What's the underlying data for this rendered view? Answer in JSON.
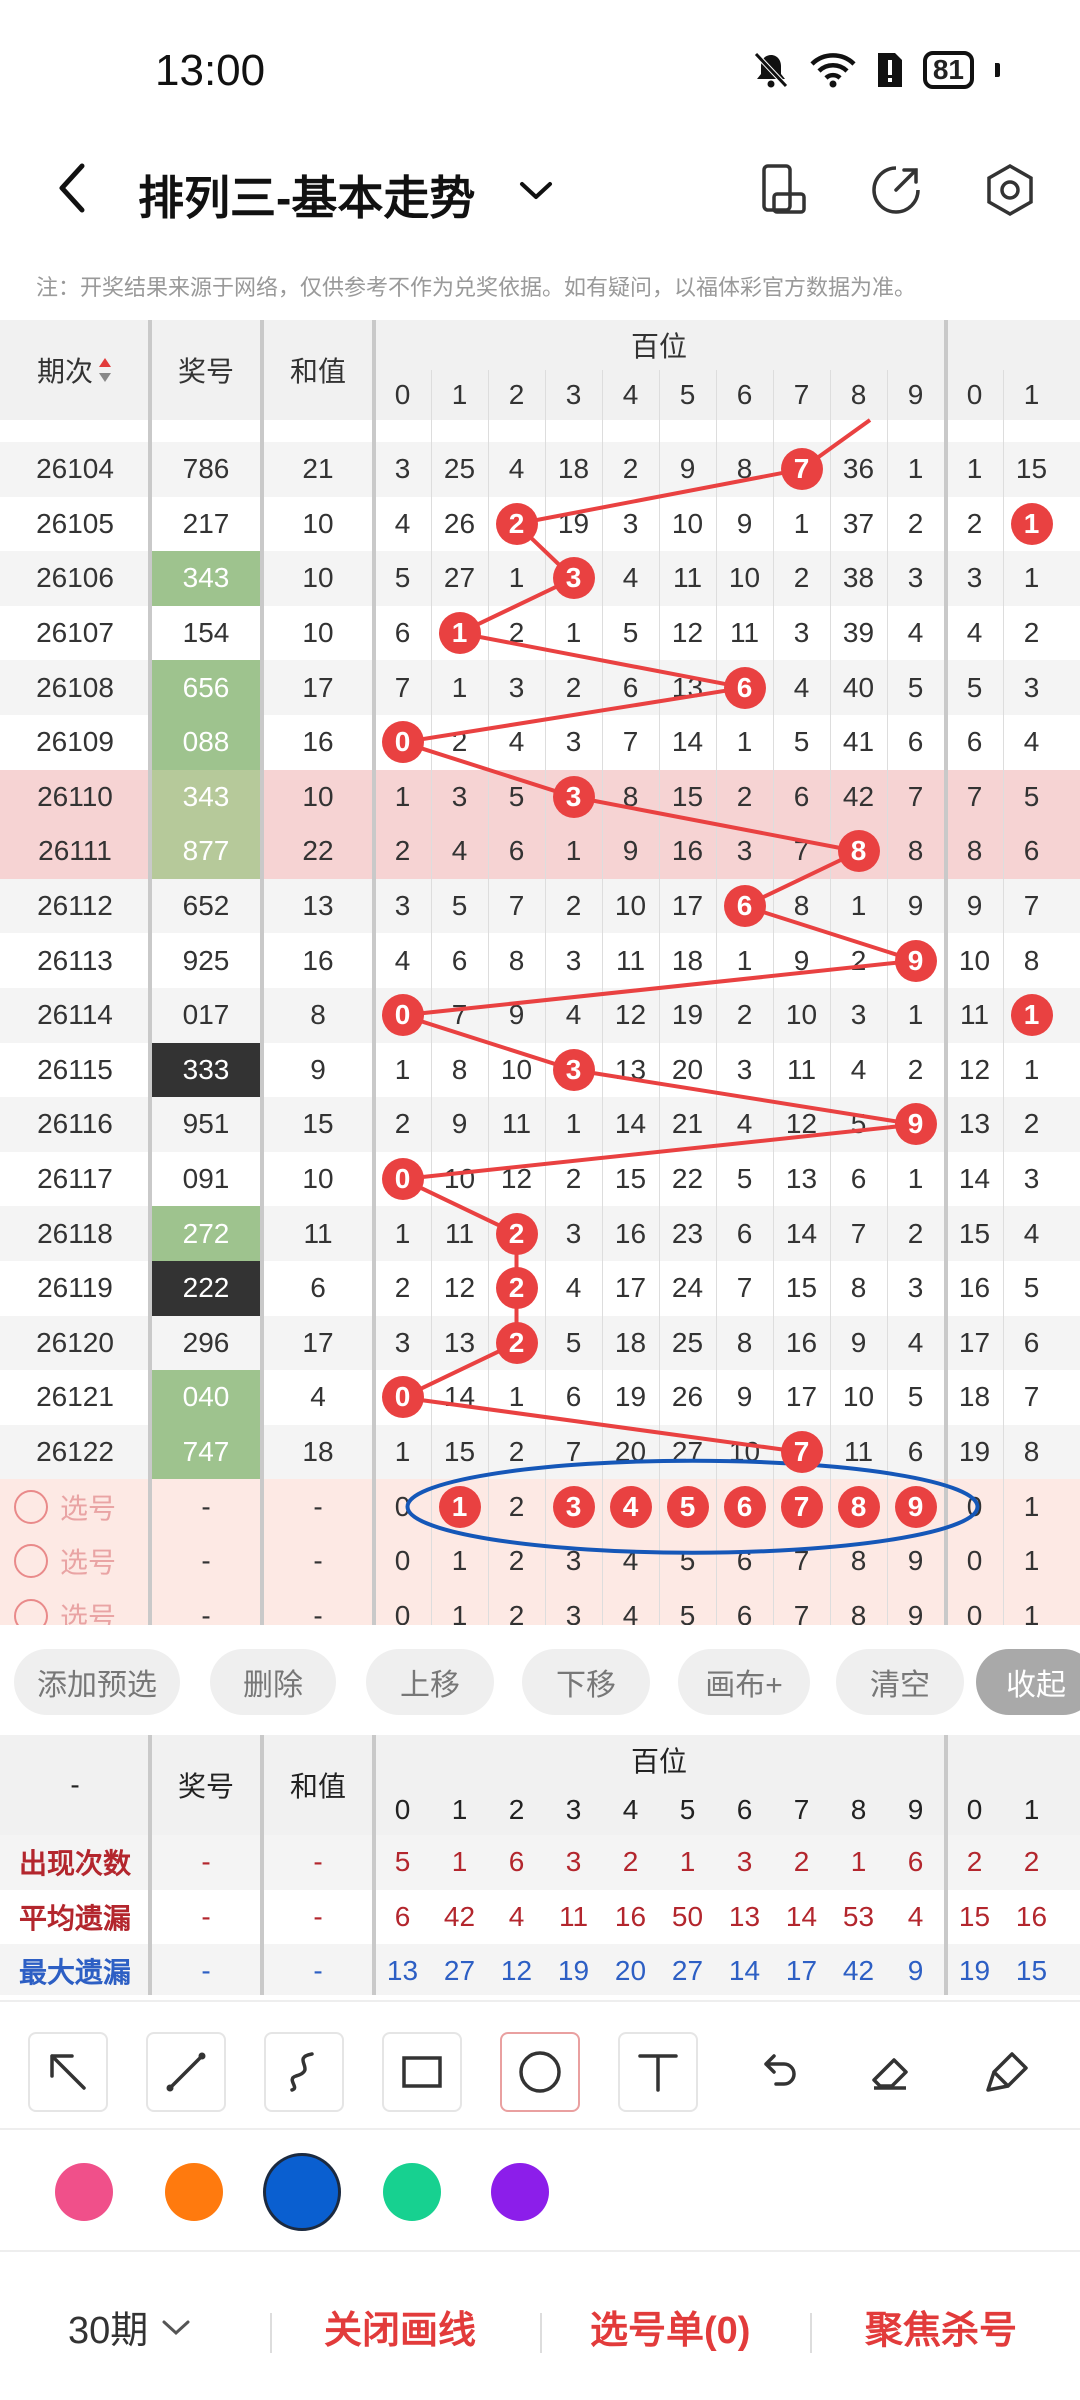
{
  "status_bar": {
    "time": "13:00",
    "battery": "81"
  },
  "header": {
    "title": "排列三-基本走势"
  },
  "notice": "注：开奖结果来源于网络，仅供参考不作为兑奖依据。如有疑问，以福体彩官方数据为准。",
  "table": {
    "col_period": "期次",
    "col_number": "奖号",
    "col_sum": "和值",
    "group_label": "百位",
    "digits": [
      "0",
      "1",
      "2",
      "3",
      "4",
      "5",
      "6",
      "7",
      "8",
      "9"
    ],
    "right_digits": [
      "0",
      "1"
    ],
    "rows": [
      {
        "period": "26104",
        "number": "786",
        "sum": "21",
        "hundreds": 7,
        "cells": [
          "3",
          "25",
          "4",
          "18",
          "2",
          "9",
          "8",
          "",
          "36",
          "1"
        ],
        "right": [
          "1",
          "15"
        ],
        "num_bg": "none"
      },
      {
        "period": "26105",
        "number": "217",
        "sum": "10",
        "hundreds": 2,
        "cells": [
          "4",
          "26",
          "",
          "19",
          "3",
          "10",
          "9",
          "1",
          "37",
          "2"
        ],
        "right": [
          "2",
          ""
        ],
        "num_bg": "none"
      },
      {
        "period": "26106",
        "number": "343",
        "sum": "10",
        "hundreds": 3,
        "cells": [
          "5",
          "27",
          "1",
          "",
          "4",
          "11",
          "10",
          "2",
          "38",
          "3"
        ],
        "right": [
          "3",
          "1"
        ],
        "num_bg": "green"
      },
      {
        "period": "26107",
        "number": "154",
        "sum": "10",
        "hundreds": 1,
        "cells": [
          "6",
          "",
          "2",
          "1",
          "5",
          "12",
          "11",
          "3",
          "39",
          "4"
        ],
        "right": [
          "4",
          "2"
        ],
        "num_bg": "none"
      },
      {
        "period": "26108",
        "number": "656",
        "sum": "17",
        "hundreds": 6,
        "cells": [
          "7",
          "1",
          "3",
          "2",
          "6",
          "13",
          "",
          "4",
          "40",
          "5"
        ],
        "right": [
          "5",
          "3"
        ],
        "num_bg": "green"
      },
      {
        "period": "26109",
        "number": "088",
        "sum": "16",
        "hundreds": 0,
        "cells": [
          "",
          "2",
          "4",
          "3",
          "7",
          "14",
          "1",
          "5",
          "41",
          "6"
        ],
        "right": [
          "6",
          "4"
        ],
        "num_bg": "green"
      },
      {
        "period": "26110",
        "number": "343",
        "sum": "10",
        "hundreds": 3,
        "cells": [
          "1",
          "3",
          "5",
          "",
          "8",
          "15",
          "2",
          "6",
          "42",
          "7"
        ],
        "right": [
          "7",
          "5"
        ],
        "num_bg": "green"
      },
      {
        "period": "26111",
        "number": "877",
        "sum": "22",
        "hundreds": 8,
        "cells": [
          "2",
          "4",
          "6",
          "1",
          "9",
          "16",
          "3",
          "7",
          "",
          "8"
        ],
        "right": [
          "8",
          "6"
        ],
        "num_bg": "green"
      },
      {
        "period": "26112",
        "number": "652",
        "sum": "13",
        "hundreds": 6,
        "cells": [
          "3",
          "5",
          "7",
          "2",
          "10",
          "17",
          "",
          "8",
          "1",
          "9"
        ],
        "right": [
          "9",
          "7"
        ],
        "num_bg": "none"
      },
      {
        "period": "26113",
        "number": "925",
        "sum": "16",
        "hundreds": 9,
        "cells": [
          "4",
          "6",
          "8",
          "3",
          "11",
          "18",
          "1",
          "9",
          "2",
          ""
        ],
        "right": [
          "10",
          "8"
        ],
        "num_bg": "none"
      },
      {
        "period": "26114",
        "number": "017",
        "sum": "8",
        "hundreds": 0,
        "cells": [
          "",
          "7",
          "9",
          "4",
          "12",
          "19",
          "2",
          "10",
          "3",
          "1"
        ],
        "right": [
          "11",
          ""
        ],
        "num_bg": "none"
      },
      {
        "period": "26115",
        "number": "333",
        "sum": "9",
        "hundreds": 3,
        "cells": [
          "1",
          "8",
          "10",
          "",
          "13",
          "20",
          "3",
          "11",
          "4",
          "2"
        ],
        "right": [
          "12",
          "1"
        ],
        "num_bg": "dark"
      },
      {
        "period": "26116",
        "number": "951",
        "sum": "15",
        "hundreds": 9,
        "cells": [
          "2",
          "9",
          "11",
          "1",
          "14",
          "21",
          "4",
          "12",
          "5",
          ""
        ],
        "right": [
          "13",
          "2"
        ],
        "num_bg": "none"
      },
      {
        "period": "26117",
        "number": "091",
        "sum": "10",
        "hundreds": 0,
        "cells": [
          "",
          "10",
          "12",
          "2",
          "15",
          "22",
          "5",
          "13",
          "6",
          "1"
        ],
        "right": [
          "14",
          "3"
        ],
        "num_bg": "none"
      },
      {
        "period": "26118",
        "number": "272",
        "sum": "11",
        "hundreds": 2,
        "cells": [
          "1",
          "11",
          "",
          "3",
          "16",
          "23",
          "6",
          "14",
          "7",
          "2"
        ],
        "right": [
          "15",
          "4"
        ],
        "num_bg": "green"
      },
      {
        "period": "26119",
        "number": "222",
        "sum": "6",
        "hundreds": 2,
        "cells": [
          "2",
          "12",
          "",
          "4",
          "17",
          "24",
          "7",
          "15",
          "8",
          "3"
        ],
        "right": [
          "16",
          "5"
        ],
        "num_bg": "dark"
      },
      {
        "period": "26120",
        "number": "296",
        "sum": "17",
        "hundreds": 2,
        "cells": [
          "3",
          "13",
          "",
          "5",
          "18",
          "25",
          "8",
          "16",
          "9",
          "4"
        ],
        "right": [
          "17",
          "6"
        ],
        "num_bg": "none"
      },
      {
        "period": "26121",
        "number": "040",
        "sum": "4",
        "hundreds": 0,
        "cells": [
          "",
          "14",
          "1",
          "6",
          "19",
          "26",
          "9",
          "17",
          "10",
          "5"
        ],
        "right": [
          "18",
          "7"
        ],
        "num_bg": "green"
      },
      {
        "period": "26122",
        "number": "747",
        "sum": "18",
        "hundreds": 7,
        "cells": [
          "1",
          "15",
          "2",
          "7",
          "20",
          "27",
          "10",
          "",
          "11",
          "6"
        ],
        "right": [
          "19",
          "8"
        ],
        "num_bg": "green"
      }
    ],
    "pick_rows": [
      {
        "label": "选号",
        "dash1": "-",
        "dash2": "-",
        "selected": [
          1,
          3,
          4,
          5,
          6,
          7,
          8,
          9
        ]
      },
      {
        "label": "选号",
        "dash1": "-",
        "dash2": "-",
        "selected": []
      },
      {
        "label": "选号",
        "dash1": "-",
        "dash2": "-",
        "selected": []
      }
    ]
  },
  "actions": [
    "添加预选",
    "删除",
    "上移",
    "下移",
    "画布+",
    "清空",
    "收起"
  ],
  "stats": {
    "head_dash": "-",
    "col_number": "奖号",
    "col_sum": "和值",
    "group_label": "百位",
    "rows": [
      {
        "label": "出现次数",
        "d1": "-",
        "d2": "-",
        "values": [
          "5",
          "1",
          "6",
          "3",
          "2",
          "1",
          "3",
          "2",
          "1",
          "6"
        ],
        "right": [
          "2",
          "2"
        ],
        "color": "#b3262d"
      },
      {
        "label": "平均遗漏",
        "d1": "-",
        "d2": "-",
        "values": [
          "6",
          "42",
          "4",
          "11",
          "16",
          "50",
          "13",
          "14",
          "53",
          "4"
        ],
        "right": [
          "15",
          "16"
        ],
        "color": "#b3262d"
      },
      {
        "label": "最大遗漏",
        "d1": "-",
        "d2": "-",
        "values": [
          "13",
          "27",
          "12",
          "19",
          "20",
          "27",
          "14",
          "17",
          "42",
          "9"
        ],
        "right": [
          "19",
          "15"
        ],
        "color": "#2d5fc4"
      }
    ]
  },
  "tools": [
    "arrow-tool-icon",
    "line-tool-icon",
    "curve-tool-icon",
    "rect-tool-icon",
    "circle-tool-icon",
    "text-tool-icon",
    "undo-icon",
    "eraser-icon",
    "clear-brush-icon"
  ],
  "colors": [
    "#f0508a",
    "#ff7a0e",
    "#0a5fd0",
    "#17d190",
    "#8c1eea"
  ],
  "bottom": {
    "period": "30期",
    "close_lines": "关闭画线",
    "pick_list": "选号单(0)",
    "focus_kill": "聚焦杀号"
  }
}
